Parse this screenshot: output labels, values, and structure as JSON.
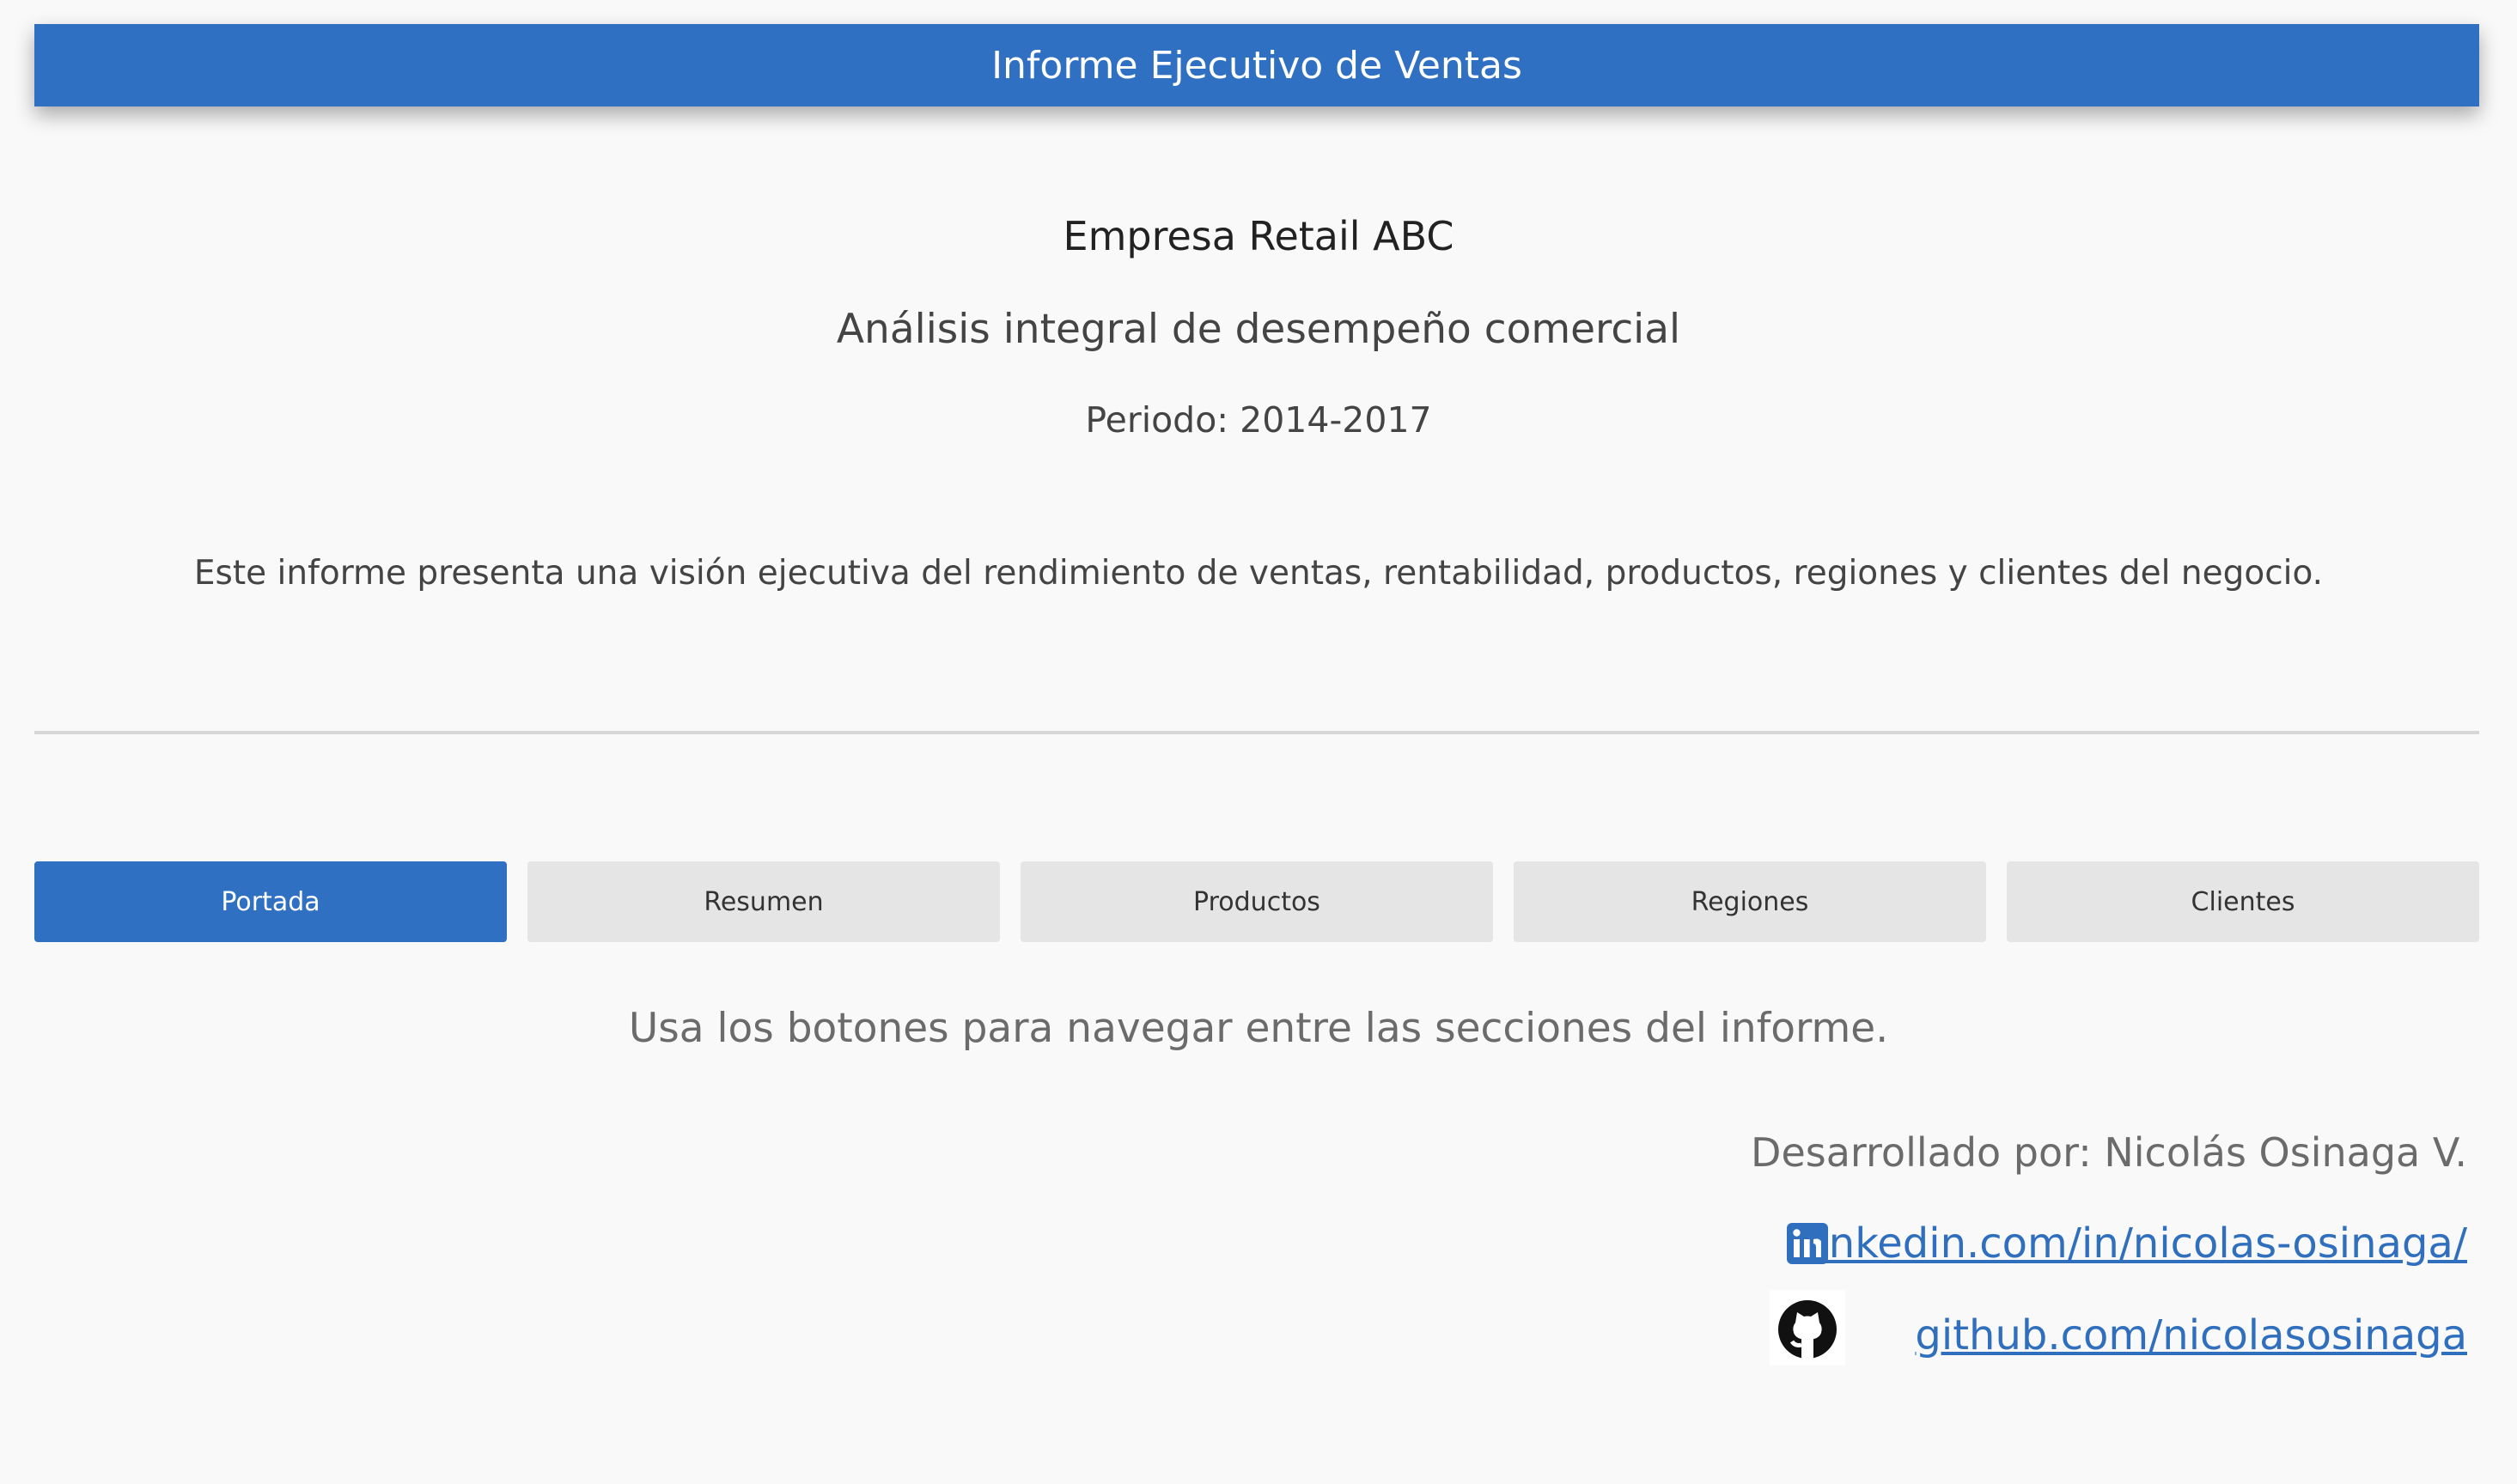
{
  "header": {
    "title": "Informe Ejecutivo de Ventas"
  },
  "cover": {
    "company": "Empresa Retail ABC",
    "subtitle": "Análisis integral de desempeño comercial",
    "period": "Periodo: 2014-2017",
    "description": "Este informe presenta una visión ejecutiva del rendimiento de ventas, rentabilidad, productos, regiones y clientes del negocio."
  },
  "nav": {
    "tabs": [
      {
        "label": "Portada",
        "active": true
      },
      {
        "label": "Resumen",
        "active": false
      },
      {
        "label": "Productos",
        "active": false
      },
      {
        "label": "Regiones",
        "active": false
      },
      {
        "label": "Clientes",
        "active": false
      }
    ],
    "hint": "Usa los botones para navegar entre las secciones del informe."
  },
  "footer": {
    "developer": "Desarrollado por: Nicolás Osinaga V.",
    "linkedin": {
      "text": "linkedin.com/in/nicolas-osinaga/",
      "icon": "linkedin-icon"
    },
    "github": {
      "text": "github.com/nicolasosinaga",
      "icon": "github-icon"
    }
  },
  "colors": {
    "accent": "#3070c2",
    "link": "#2f6fbe",
    "tab_inactive": "#e5e5e5",
    "background": "#f9f9f9"
  }
}
